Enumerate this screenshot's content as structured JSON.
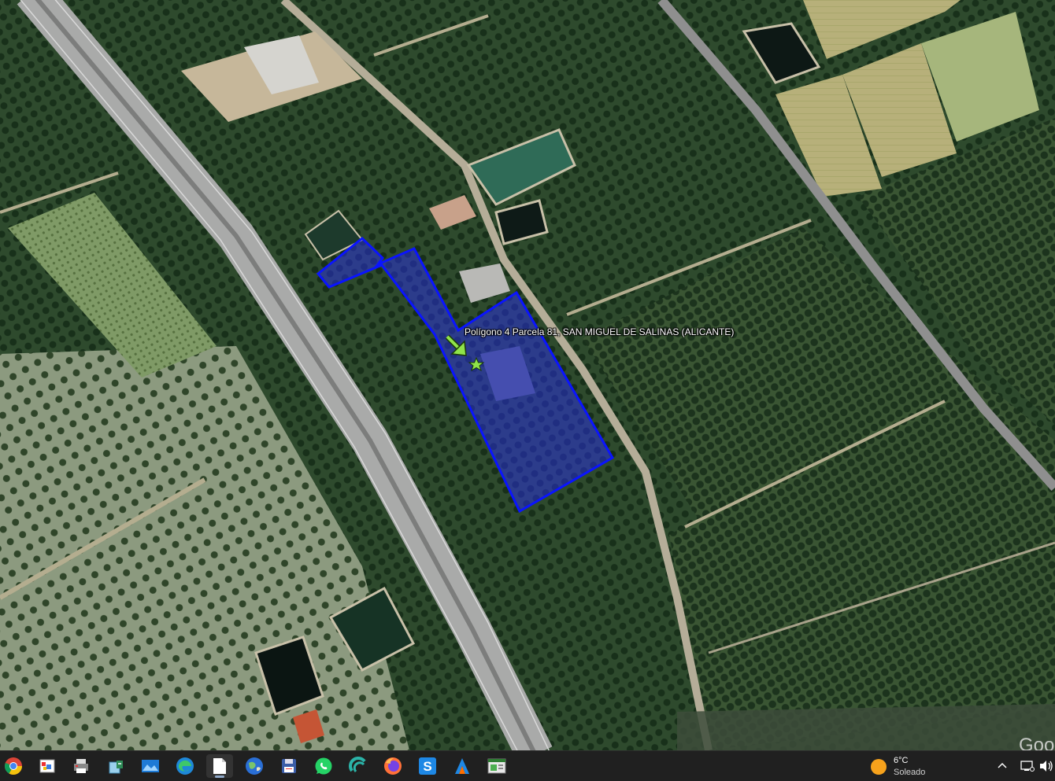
{
  "map": {
    "type": "satellite",
    "placemark": {
      "label": "Polígono 4 Parcela 81, SAN MIGUEL DE SALINAS (ALICANTE)"
    },
    "parcel_style": {
      "stroke": "#0a14ff",
      "fill": "#2a2cff",
      "fill_opacity": 0.45
    },
    "watermark": "Goo"
  },
  "taskbar": {
    "icons": [
      {
        "name": "chrome-icon"
      },
      {
        "name": "paint-icon"
      },
      {
        "name": "printer-icon"
      },
      {
        "name": "recycle-icon"
      },
      {
        "name": "photos-icon"
      },
      {
        "name": "edge-icon"
      },
      {
        "name": "file-icon"
      },
      {
        "name": "google-earth-icon"
      },
      {
        "name": "save-icon"
      },
      {
        "name": "whatsapp-icon"
      },
      {
        "name": "app-icon"
      },
      {
        "name": "firefox-icon"
      },
      {
        "name": "s-app-icon"
      },
      {
        "name": "arrow-app-icon"
      },
      {
        "name": "window-app-icon"
      }
    ],
    "weather": {
      "temp": "6°C",
      "condition": "Soleado"
    },
    "tray": [
      "chevron-up-icon",
      "network-icon",
      "volume-icon"
    ]
  }
}
